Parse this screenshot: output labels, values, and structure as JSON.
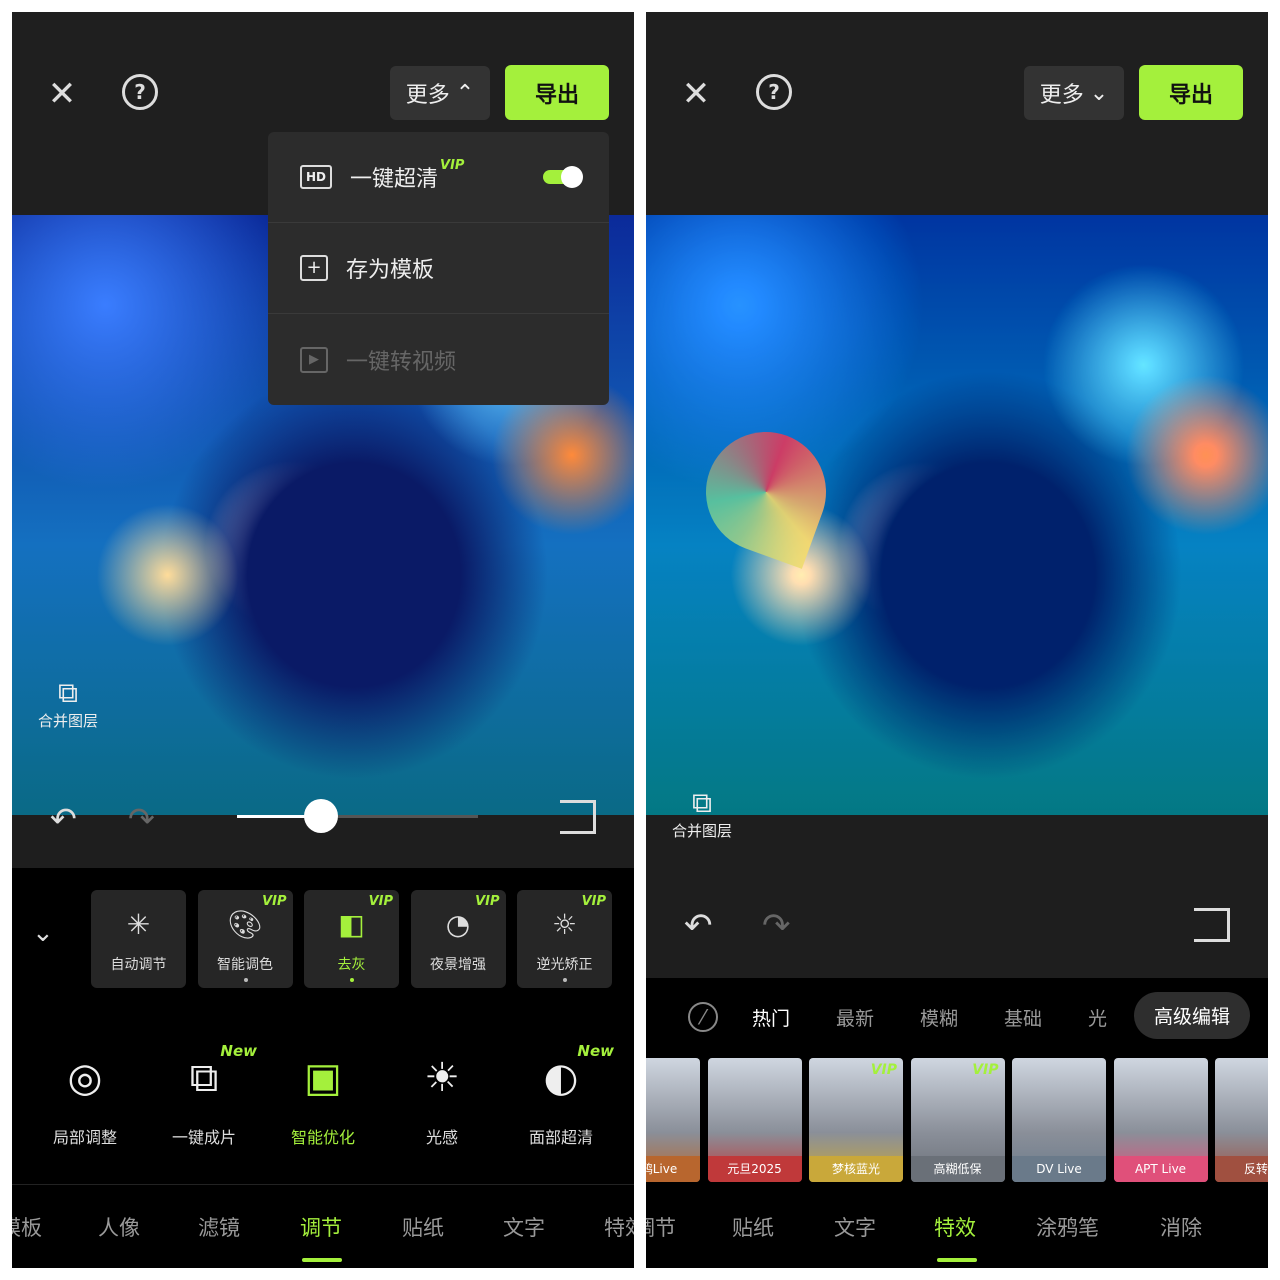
{
  "left": {
    "header": {
      "more_label": "更多",
      "more_chevron": "chevron-up",
      "export_label": "导出"
    },
    "menu": [
      {
        "icon": "hd-icon",
        "label": "一键超清",
        "badge": "VIP",
        "toggle_on": true
      },
      {
        "icon": "save-template-icon",
        "label": "存为模板"
      },
      {
        "icon": "video-convert-icon",
        "label": "一键转视频",
        "disabled": true
      }
    ],
    "merge_layers": "合并图层",
    "slider_value": 0.35,
    "adjust_cards": [
      {
        "label": "自动调节",
        "icon": "auto-adjust-icon",
        "badge": ""
      },
      {
        "label": "智能调色",
        "icon": "palette-icon",
        "badge": "VIP"
      },
      {
        "label": "去灰",
        "icon": "dehaze-icon",
        "badge": "VIP",
        "active": true
      },
      {
        "label": "夜景增强",
        "icon": "night-icon",
        "badge": "VIP"
      },
      {
        "label": "逆光矫正",
        "icon": "backlight-icon",
        "badge": "VIP"
      }
    ],
    "tools": [
      {
        "label": "局部调整",
        "icon": "local-adjust-icon"
      },
      {
        "label": "一键成片",
        "icon": "one-click-icon",
        "badge": "New"
      },
      {
        "label": "智能优化",
        "icon": "smart-optimize-icon",
        "active": true
      },
      {
        "label": "光感",
        "icon": "light-icon"
      },
      {
        "label": "面部超清",
        "icon": "face-hd-icon",
        "badge": "New"
      }
    ],
    "bottom_tabs": [
      "模板",
      "人像",
      "滤镜",
      "调节",
      "贴纸",
      "文字",
      "特效"
    ],
    "active_tab": "调节"
  },
  "right": {
    "header": {
      "more_label": "更多",
      "more_chevron": "chevron-down",
      "export_label": "导出"
    },
    "merge_layers": "合并图层",
    "filter_tabs": [
      "热门",
      "最新",
      "模糊",
      "基础",
      "光",
      "高级编辑"
    ],
    "active_filter_tab": "热门",
    "effects": [
      {
        "label": "涂鸦Live",
        "color": "#b8662e"
      },
      {
        "label": "元旦2025",
        "color": "#c0393a"
      },
      {
        "label": "梦核蓝光",
        "color": "#c9a83a",
        "badge": "VIP"
      },
      {
        "label": "高糊低保",
        "color": "#6a7078",
        "badge": "VIP"
      },
      {
        "label": "DV Live",
        "color": "#6a7a8a"
      },
      {
        "label": "APT Live",
        "color": "#e0507a"
      },
      {
        "label": "反转摇",
        "color": "#a05040"
      }
    ],
    "bottom_tabs": [
      "调节",
      "贴纸",
      "文字",
      "特效",
      "涂鸦笔",
      "消除"
    ],
    "active_tab": "特效"
  },
  "colors": {
    "accent": "#a4f03c"
  }
}
